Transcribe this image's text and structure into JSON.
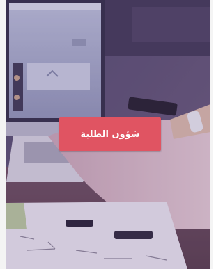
{
  "cta": {
    "label": "شؤون الطلبة"
  },
  "colors": {
    "button": "#e05462",
    "overlay": "#5a4e78"
  }
}
